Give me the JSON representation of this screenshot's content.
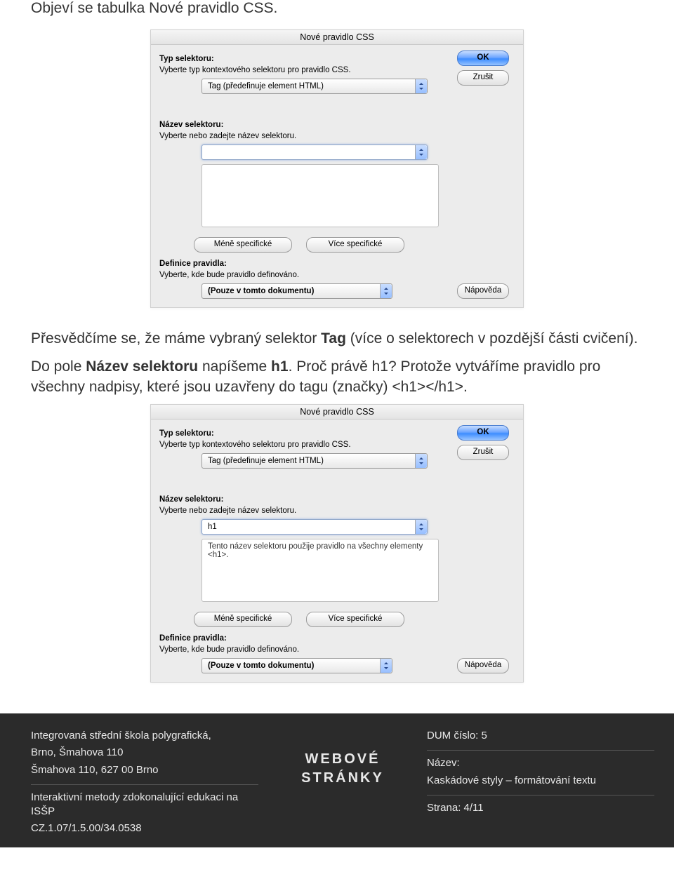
{
  "intro": "Objeví se tabulka Nové pravidlo CSS.",
  "para2_pre": "Přesvědčíme se, že máme vybraný selektor ",
  "para2_bold": "Tag",
  "para2_post": " (více o selektorech v pozdější části cvičení).",
  "para3_a": "Do pole ",
  "para3_b": "Název selektoru",
  "para3_c": " napíšeme ",
  "para3_d": "h1",
  "para3_e": ". Proč právě h1? Protože vytváříme pravidlo pro všechny nadpisy, které jsou uzavřeny do tagu (značky) <h1></h1>.",
  "dialog": {
    "title": "Nové pravidlo CSS",
    "typLabel": "Typ selektoru:",
    "typHelp": "Vyberte typ kontextového selektoru pro pravidlo CSS.",
    "typSelected": "Tag (předefinuje element HTML)",
    "nazevLabel": "Název selektoru:",
    "nazevHelp": "Vyberte nebo zadejte název selektoru.",
    "lessSpecific": "Méně specifické",
    "moreSpecific": "Více specifické",
    "defLabel": "Definice pravidla:",
    "defHelp": "Vyberte, kde bude pravidlo definováno.",
    "defSelected": "(Pouze v tomto dokumentu)",
    "ok": "OK",
    "cancel": "Zrušit",
    "help": "Nápověda"
  },
  "dialog2": {
    "nazevValue": "h1",
    "description": "Tento název selektoru použije pravidlo na všechny elementy <h1>."
  },
  "footer": {
    "school1": "Integrovaná střední škola polygrafická,",
    "school2": "Brno, Šmahova 110",
    "school3": "Šmahova 110, 627 00 Brno",
    "proj1": "Interaktivní metody zdokonalující edukaci na ISŠP",
    "proj2": "CZ.1.07/1.5.00/34.0538",
    "mid1": "WEBOVÉ",
    "mid2": "STRÁNKY",
    "dum": "DUM číslo: 5",
    "nazev": "Název:",
    "nazevVal": "Kaskádové styly – formátování textu",
    "page": "Strana: 4/11"
  }
}
